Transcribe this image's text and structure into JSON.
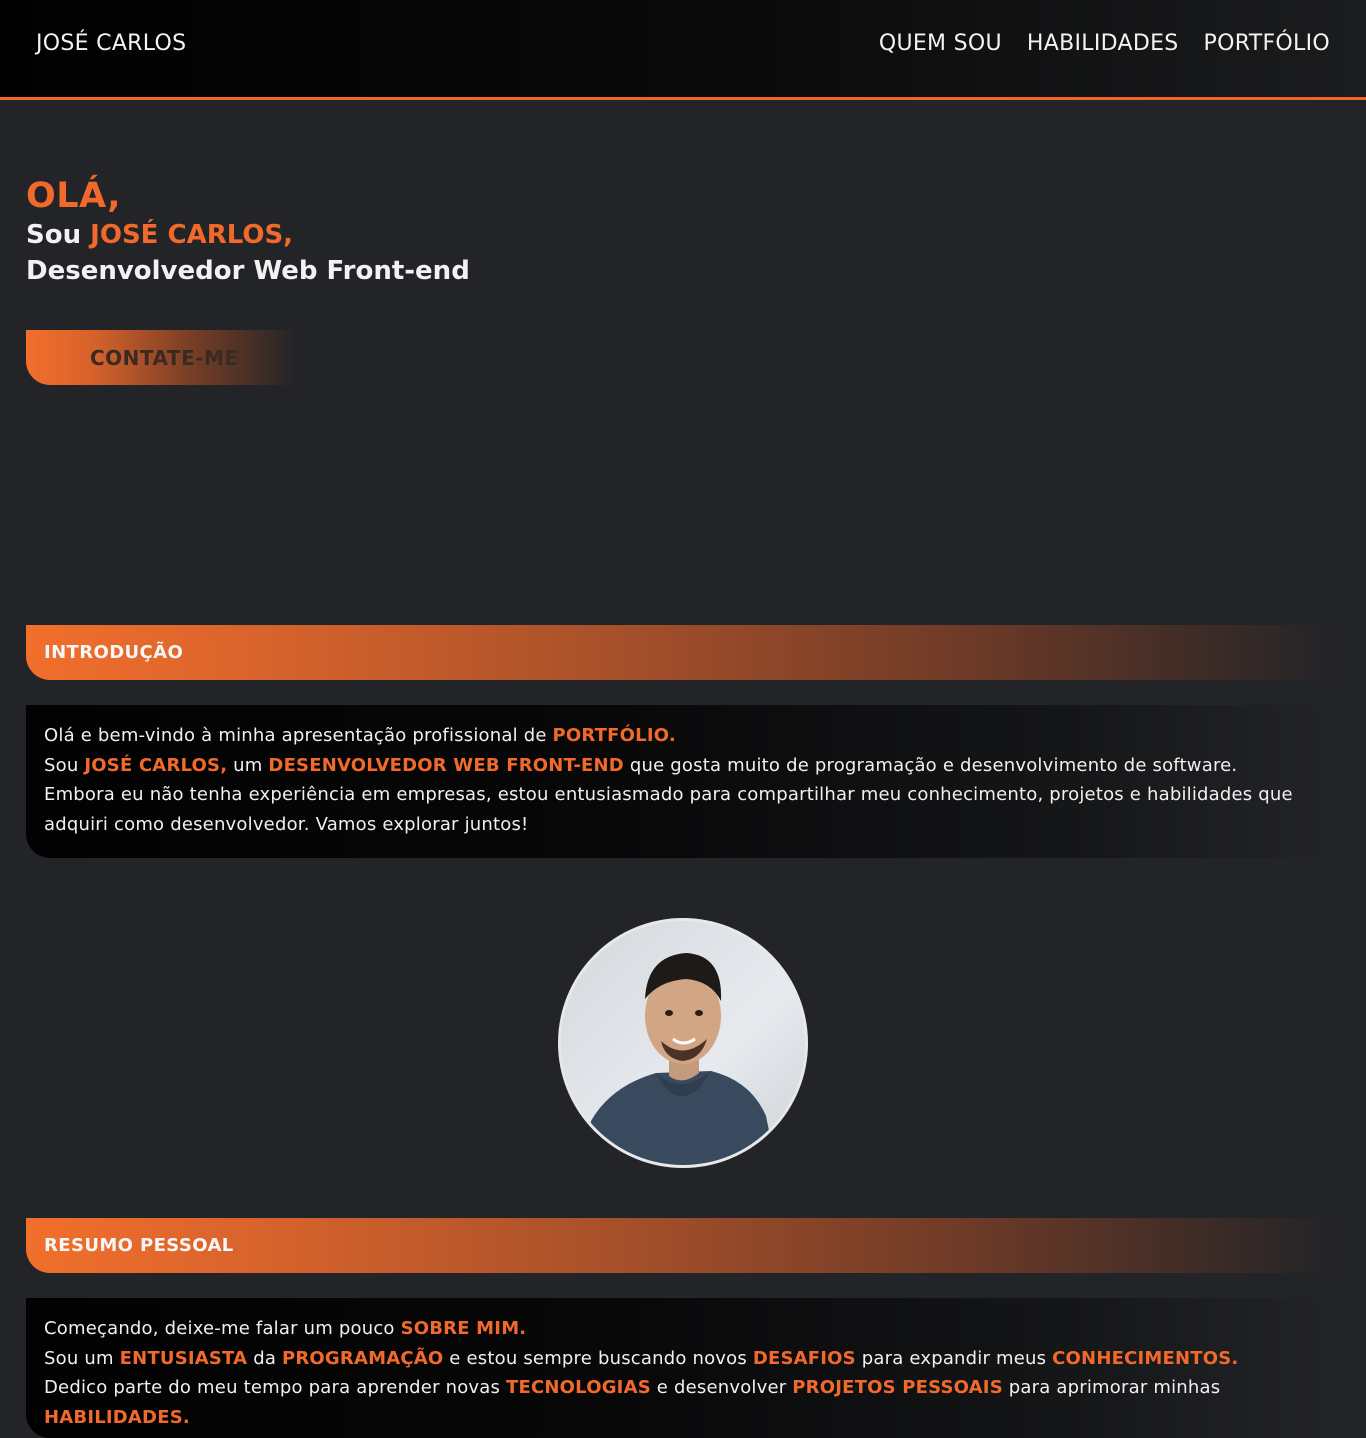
{
  "nav": {
    "brand": "JOSÉ CARLOS",
    "links": [
      "QUEM SOU",
      "HABILIDADES",
      "PORTFÓLIO"
    ]
  },
  "hero": {
    "greeting": "OLÁ,",
    "sou_prefix": "Sou",
    "name": "JOSÉ CARLOS,",
    "role": "Desenvolvedor Web Front-end",
    "cta": "CONTATE-ME"
  },
  "intro": {
    "heading": "INTRODUÇÃO",
    "line1_a": "Olá e bem-vindo à minha apresentação profissional de",
    "line1_hl": "PORTFÓLIO.",
    "line2_a": "Sou",
    "line2_hl1": "JOSÉ CARLOS,",
    "line2_b": "um",
    "line2_hl2": "DESENVOLVEDOR WEB FRONT-END",
    "line2_c": "que gosta muito de programação e desenvolvimento de software.",
    "line3": "Embora eu não tenha experiência em empresas, estou entusiasmado para compartilhar meu conhecimento, projetos e habilidades que adquiri como desenvolvedor. Vamos explorar juntos!"
  },
  "summary": {
    "heading": "RESUMO PESSOAL",
    "line1_a": "Começando, deixe-me falar um pouco",
    "line1_hl": "SOBRE MIM.",
    "line2_a": "Sou um",
    "line2_hl1": "ENTUSIASTA",
    "line2_b": "da",
    "line2_hl2": "PROGRAMAÇÃO",
    "line2_c": "e estou sempre buscando novos",
    "line2_hl3": "DESAFIOS",
    "line2_d": "para expandir meus",
    "line2_hl4": "CONHECIMENTOS.",
    "line3_a": "Dedico parte do meu tempo para aprender novas",
    "line3_hl1": "TECNOLOGIAS",
    "line3_b": "e desenvolver",
    "line3_hl2": "PROJETOS PESSOAIS",
    "line3_c": "para aprimorar minhas",
    "line4_hl": "HABILIDADES."
  },
  "colors": {
    "accent": "#f16a2b",
    "background": "#232427",
    "navbar": "#050505"
  }
}
